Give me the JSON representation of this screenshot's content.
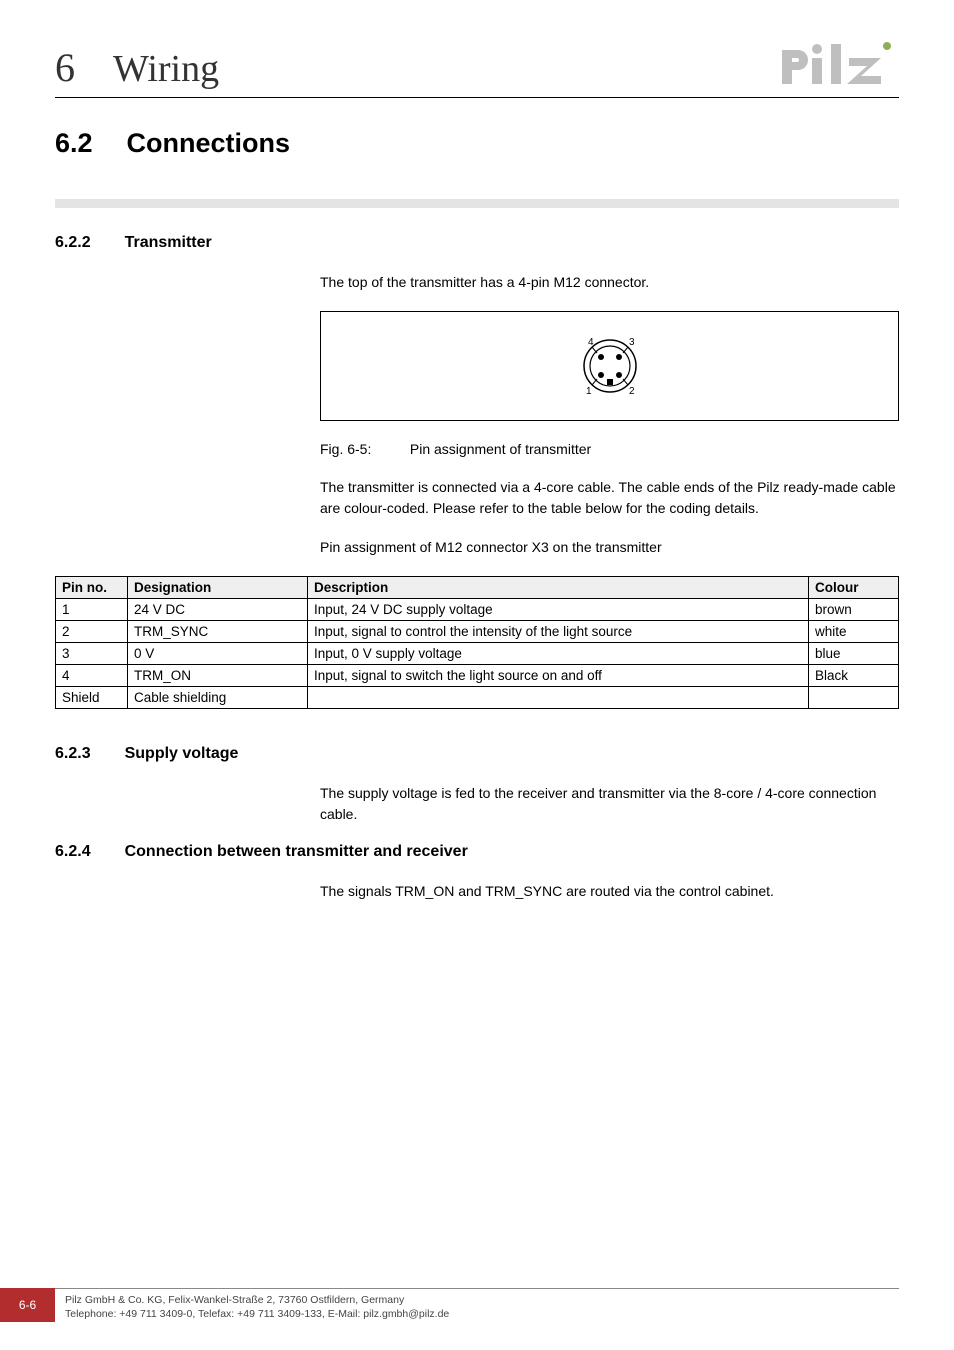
{
  "header": {
    "chapter_num": "6",
    "chapter_name": "Wiring"
  },
  "section": {
    "num": "6.2",
    "name": "Connections"
  },
  "sub1": {
    "num": "6.2.2",
    "name": "Transmitter",
    "intro": "The top of the transmitter has a 4-pin M12 connector.",
    "fig_label": "Fig. 6-5:",
    "fig_caption": "Pin assignment of transmitter",
    "para2": "The transmitter is connected via a 4-core cable. The cable ends of the Pilz ready-made cable are colour-coded. Please refer to the table below for the coding details.",
    "para3": "Pin assignment of M12 connector X3 on the transmitter",
    "connector_pins": {
      "p1": "1",
      "p2": "2",
      "p3": "3",
      "p4": "4"
    }
  },
  "table": {
    "headers": {
      "pin": "Pin no.",
      "des": "Designation",
      "desc": "Description",
      "col": "Colour"
    },
    "rows": [
      {
        "pin": "1",
        "des": "24 V DC",
        "desc": "Input, 24 V DC supply voltage",
        "col": "brown"
      },
      {
        "pin": "2",
        "des": "TRM_SYNC",
        "desc": "Input, signal to control the intensity of the light source",
        "col": "white"
      },
      {
        "pin": "3",
        "des": "0 V",
        "desc": "Input, 0 V supply voltage",
        "col": "blue"
      },
      {
        "pin": "4",
        "des": "TRM_ON",
        "desc": "Input, signal to switch the light source on and off",
        "col": "Black"
      },
      {
        "pin": "Shield",
        "des": "Cable shielding",
        "desc": "",
        "col": ""
      }
    ]
  },
  "sub2": {
    "num": "6.2.3",
    "name": "Supply voltage",
    "para": "The supply voltage is fed to the receiver and transmitter via the 8-core / 4-core connection cable."
  },
  "sub3": {
    "num": "6.2.4",
    "name": "Connection between transmitter and receiver",
    "para": "The signals TRM_ON and TRM_SYNC are routed via the control cabinet."
  },
  "footer": {
    "page": "6-6",
    "line1": "Pilz GmbH & Co. KG, Felix-Wankel-Straße 2, 73760 Ostfildern, Germany",
    "line2": "Telephone: +49 711 3409-0, Telefax: +49 711 3409-133, E-Mail: pilz.gmbh@pilz.de"
  }
}
